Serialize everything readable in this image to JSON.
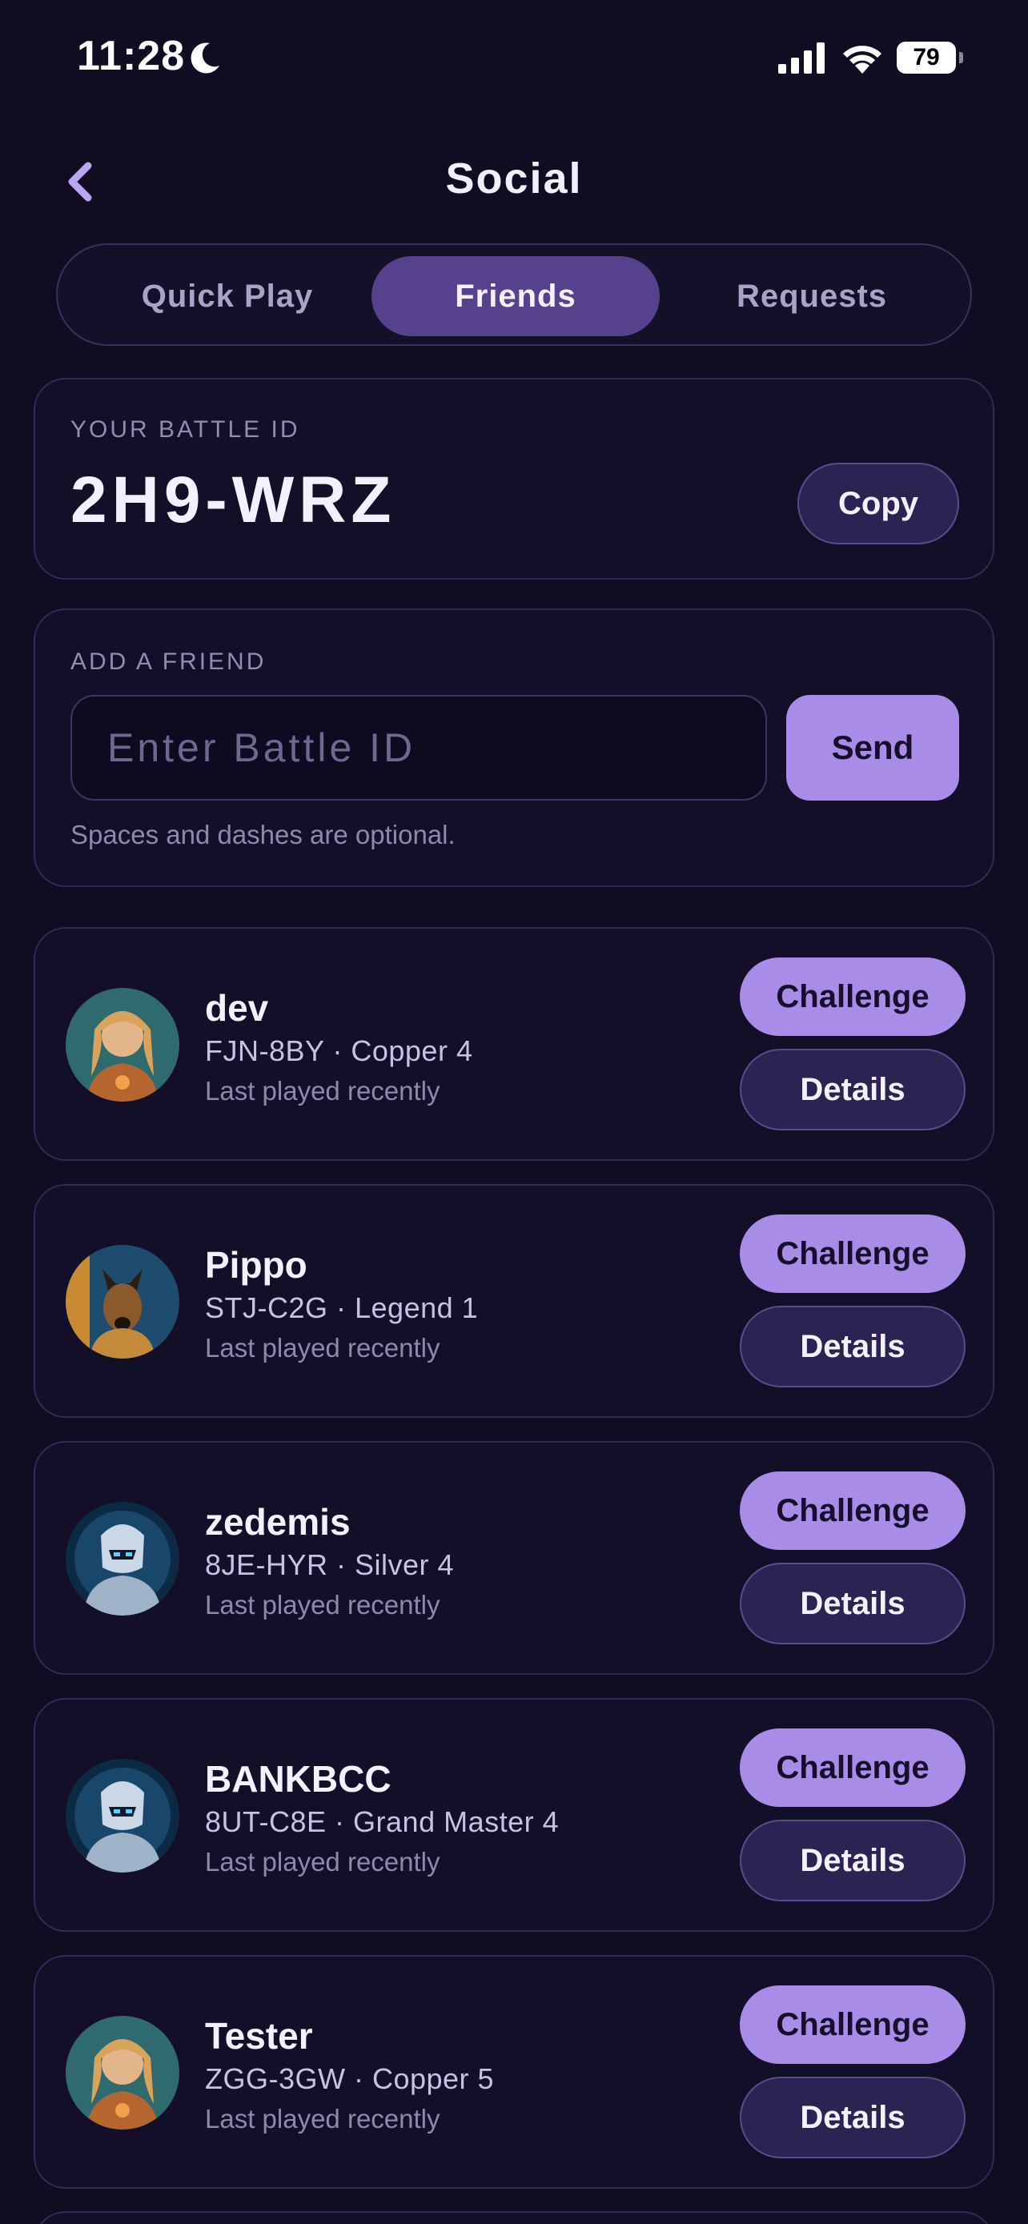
{
  "status_bar": {
    "time": "11:28",
    "battery_level": "79"
  },
  "header": {
    "title": "Social",
    "back_icon": "chevron-left-icon"
  },
  "tabs": [
    {
      "label": "Quick Play",
      "active": false
    },
    {
      "label": "Friends",
      "active": true
    },
    {
      "label": "Requests",
      "active": false
    }
  ],
  "battle_id": {
    "label": "YOUR BATTLE ID",
    "value": "2H9-WRZ",
    "copy_label": "Copy"
  },
  "add_friend": {
    "label": "ADD A FRIEND",
    "placeholder": "Enter Battle ID",
    "value": "",
    "send_label": "Send",
    "hint": "Spaces and dashes are optional."
  },
  "friends": [
    {
      "name": "dev",
      "subtitle": "FJN-8BY · Copper 4",
      "meta": "Last played recently",
      "avatar": "elf-warrior-avatar",
      "challenge_label": "Challenge",
      "details_label": "Details"
    },
    {
      "name": "Pippo",
      "subtitle": "STJ-C2G · Legend 1",
      "meta": "Last played recently",
      "avatar": "armored-dog-avatar",
      "challenge_label": "Challenge",
      "details_label": "Details"
    },
    {
      "name": "zedemis",
      "subtitle": "8JE-HYR · Silver 4",
      "meta": "Last played recently",
      "avatar": "cyber-knight-avatar",
      "challenge_label": "Challenge",
      "details_label": "Details"
    },
    {
      "name": "BANKBCC",
      "subtitle": "8UT-C8E · Grand Master 4",
      "meta": "Last played recently",
      "avatar": "cyber-knight-avatar",
      "challenge_label": "Challenge",
      "details_label": "Details"
    },
    {
      "name": "Tester",
      "subtitle": "ZGG-3GW · Copper 5",
      "meta": "Last played recently",
      "avatar": "elf-warrior-avatar",
      "challenge_label": "Challenge",
      "details_label": "Details"
    }
  ],
  "colors": {
    "background": "#100d22",
    "card": "#130f28",
    "accent": "#a98be8",
    "tab_active": "#56418c",
    "secondary_button": "#2c2352"
  }
}
